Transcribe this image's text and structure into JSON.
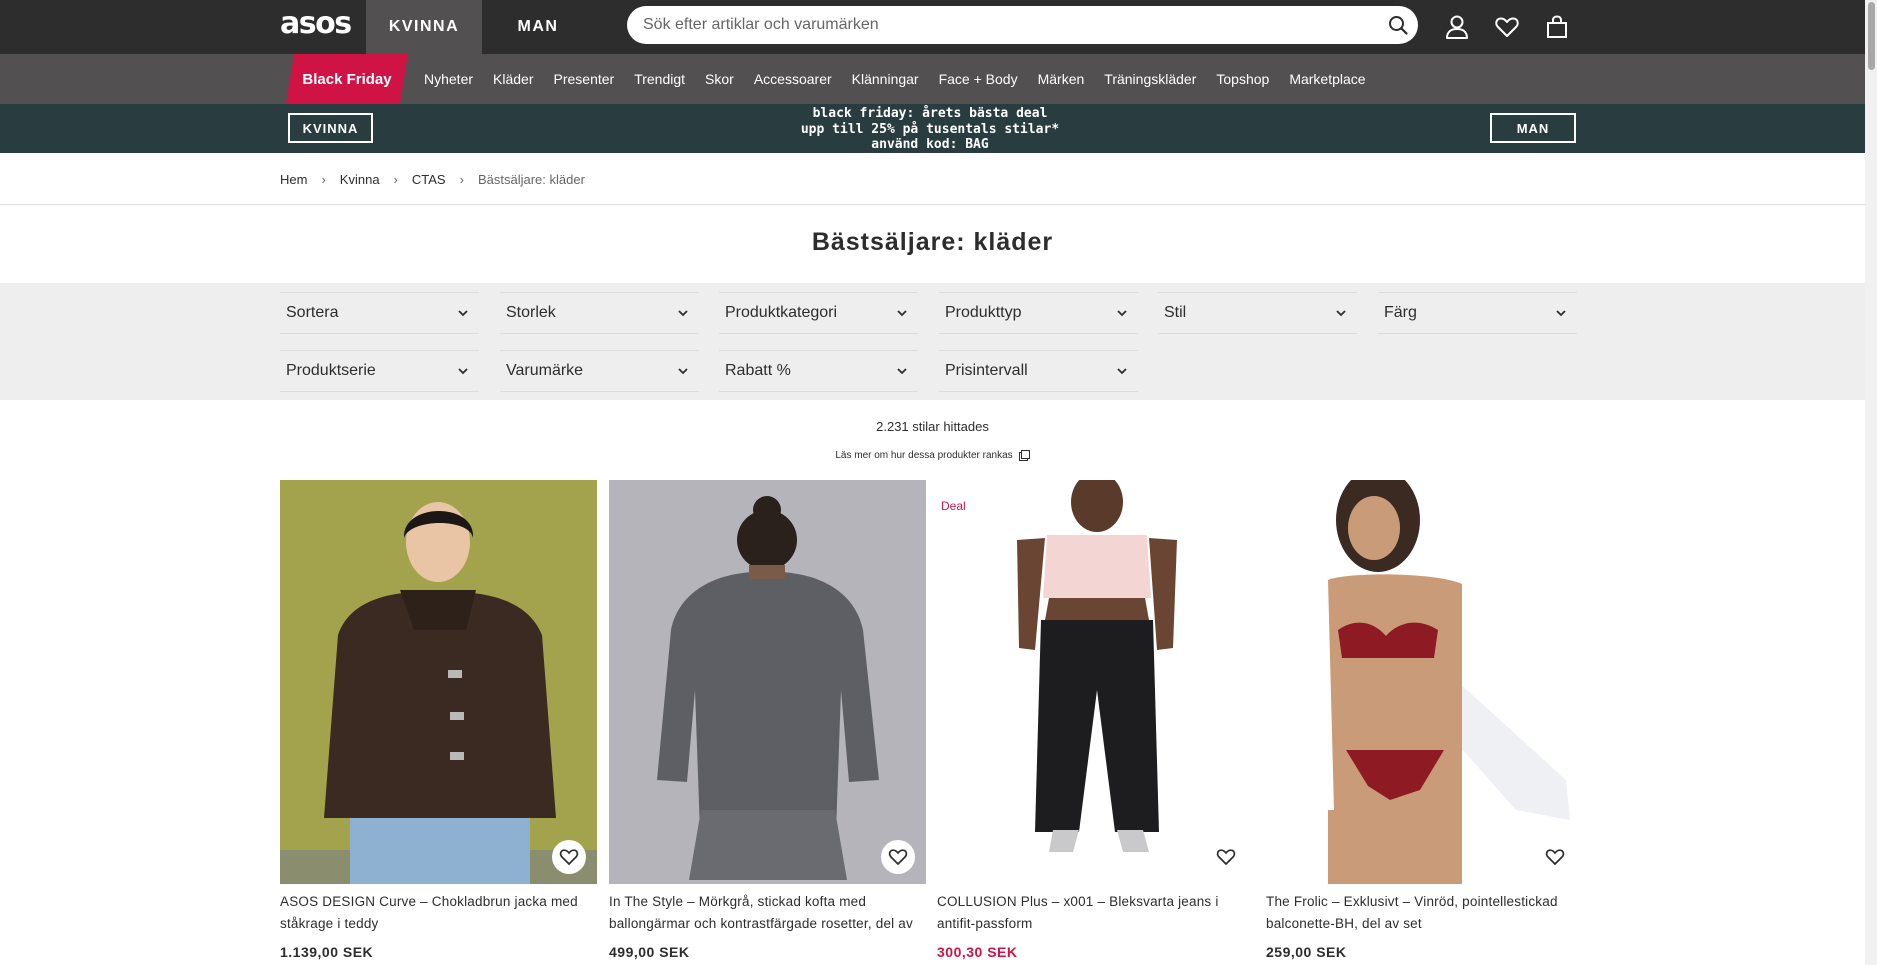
{
  "header": {
    "logo": "asos",
    "tabs": [
      "KVINNA",
      "MAN"
    ],
    "search_placeholder": "Sök efter artiklar och varumärken",
    "icons": [
      "search-icon",
      "account-icon",
      "saved-items-heart-icon",
      "bag-icon"
    ]
  },
  "nav": {
    "highlight": "Black Friday",
    "items": [
      "Nyheter",
      "Kläder",
      "Presenter",
      "Trendigt",
      "Skor",
      "Accessoarer",
      "Klänningar",
      "Face + Body",
      "Märken",
      "Träningskläder",
      "Topshop",
      "Marketplace"
    ],
    "highlight_color": "#d01345"
  },
  "promo": {
    "left_button": "KVINNA",
    "right_button": "MAN",
    "line1": "black friday: årets bästa deal",
    "line2": "upp till 25% på tusentals stilar*",
    "line3": "använd kod: BAG",
    "background": "#293c3f"
  },
  "breadcrumb": [
    "Hem",
    "Kvinna",
    "CTAS",
    "Bästsäljare: kläder"
  ],
  "page_title": "Bästsäljare: kläder",
  "filters": {
    "row1": [
      "Sortera",
      "Storlek",
      "Produktkategori",
      "Produkttyp",
      "Stil",
      "Färg"
    ],
    "row2": [
      "Produktserie",
      "Varumärke",
      "Rabatt %",
      "Prisintervall"
    ]
  },
  "results": {
    "count": "2.231 stilar hittades",
    "ranking_link": "Läs mer om hur dessa produkter rankas"
  },
  "products": [
    {
      "name": "ASOS DESIGN Curve – Chokladbrun jacka med ståkrage i teddy",
      "price": "1.139,00 SEK",
      "badge": "",
      "sale": false
    },
    {
      "name": "In The Style – Mörkgrå, stickad kofta med ballongärmar och kontrastfärgade rosetter, del av set",
      "price": "499,00 SEK",
      "badge": "",
      "sale": false
    },
    {
      "name": "COLLUSION Plus – x001 – Bleksvarta jeans i antifit-passform",
      "price": "300,30 SEK",
      "badge": "Deal",
      "sale": true
    },
    {
      "name": "The Frolic – Exklusivt – Vinröd, pointellestickad balconette-BH, del av set",
      "price": "259,00 SEK",
      "badge": "",
      "sale": false
    }
  ]
}
